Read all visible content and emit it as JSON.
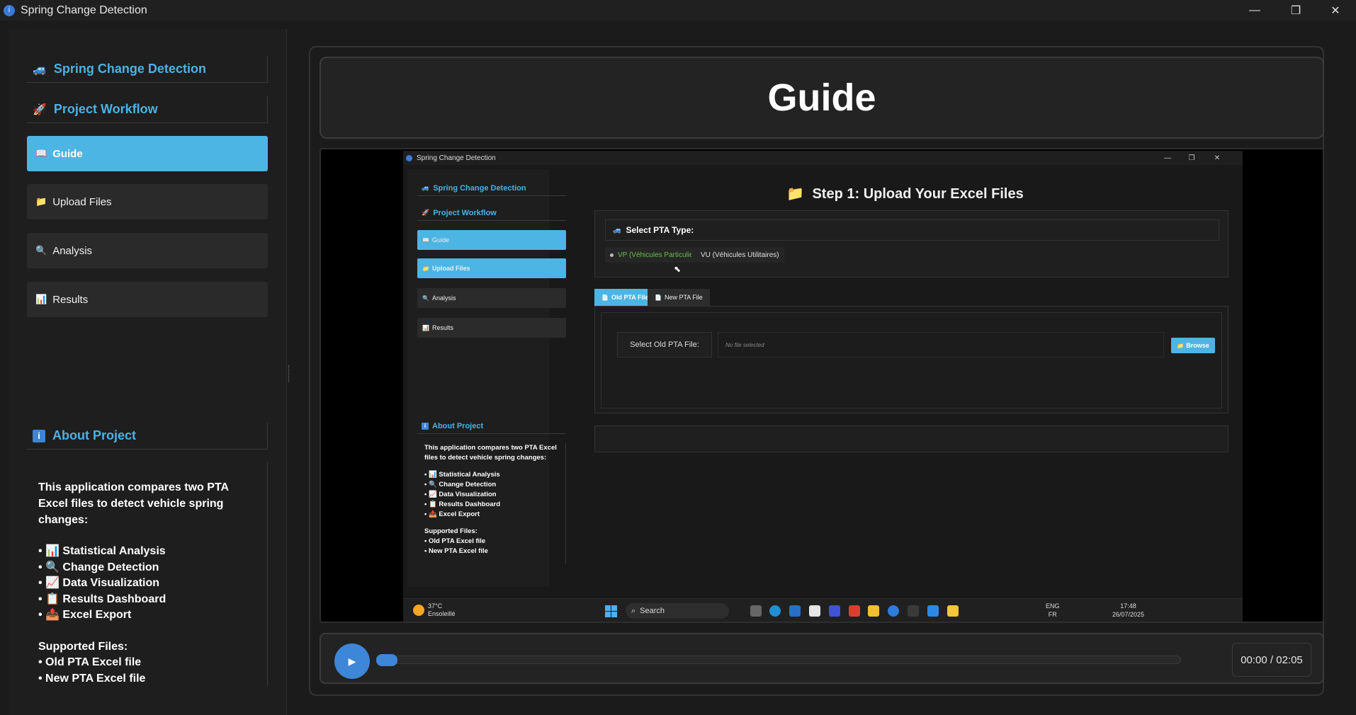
{
  "window": {
    "title": "Spring Change Detection",
    "minimize": "—",
    "maximize": "❐",
    "close": "✕"
  },
  "sidebar": {
    "app_header": "Spring Change Detection",
    "workflow_header": "Project Workflow",
    "items": [
      {
        "label": "Guide",
        "icon": "📖",
        "active": true
      },
      {
        "label": "Upload Files",
        "icon": "📁",
        "active": false
      },
      {
        "label": "Analysis",
        "icon": "🔍",
        "active": false
      },
      {
        "label": "Results",
        "icon": "📊",
        "active": false
      }
    ],
    "about_header": "About Project",
    "about_intro": "This application compares two PTA Excel files to detect vehicle spring changes:",
    "features": [
      "• 📊 Statistical Analysis",
      "• 🔍 Change Detection",
      "• 📈 Data Visualization",
      "• 📋 Results Dashboard",
      "• 📤 Excel Export"
    ],
    "supported_title": "Supported Files:",
    "supported": [
      "• Old PTA Excel file",
      "• New PTA Excel file"
    ]
  },
  "main": {
    "page_title": "Guide"
  },
  "video": {
    "window_title": "Spring Change Detection",
    "sidebar": {
      "app_header": "Spring Change Detection",
      "workflow_header": "Project Workflow",
      "items": [
        "Guide",
        "Upload Files",
        "Analysis",
        "Results"
      ],
      "about_header": "About Project",
      "about_intro": "This application compares two PTA Excel files to detect vehicle spring changes:",
      "features": [
        "• 📊 Statistical Analysis",
        "• 🔍 Change Detection",
        "• 📈 Data Visualization",
        "• 📋 Results Dashboard",
        "• 📤 Excel Export"
      ],
      "supported_title": "Supported Files:",
      "supported": [
        "• Old PTA Excel file",
        "• New PTA Excel file"
      ]
    },
    "step_title": "Step 1: Upload Your Excel Files",
    "pta_type_label": "Select PTA Type:",
    "radio_vp": "VP (Véhicules Particuliers)",
    "radio_vu": "VU (Véhicules Utilitaires)",
    "tab_old": "Old PTA File",
    "tab_new": "New PTA File",
    "select_label": "Select Old PTA File:",
    "file_placeholder": "No file selected",
    "browse": "Browse",
    "taskbar": {
      "temp": "37°C",
      "weather": "Ensoleillé",
      "search": "Search",
      "lang1": "ENG",
      "lang2": "FR",
      "time": "17:48",
      "date": "26/07/2025"
    }
  },
  "player": {
    "play_icon": "▶",
    "time": "00:00 / 02:05",
    "progress": 0.0
  },
  "colors": {
    "accent": "#4db5e4",
    "header_text": "#4ab3e6",
    "play": "#3d86d8",
    "success_green": "#6bbf4e"
  }
}
